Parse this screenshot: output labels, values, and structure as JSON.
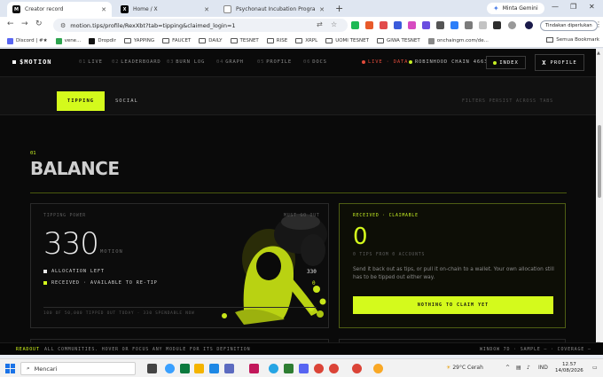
{
  "browser": {
    "tabs": [
      {
        "title": "Creator record",
        "active": true
      },
      {
        "title": "Home / X",
        "active": false
      },
      {
        "title": "Psychonaut Incubation Progra...",
        "active": false
      }
    ],
    "profile": "Minta Gemini",
    "url": "motion.tips/profile/RexXbt?tab=tipping&claimed_login=1",
    "action_button": "Tindakan diperlukan",
    "bookmarks": [
      "Discord | #★",
      "vene...",
      "Dropdir",
      "YAPPING",
      "FAUCET",
      "DAILY",
      "TESNET",
      "RISE",
      "XRPL",
      "UOMI TESNET",
      "GIWA TESNET",
      "onchaingm.com/de..."
    ],
    "all_bookmarks": "Semua Bookmark"
  },
  "site": {
    "brand": "$MOTION",
    "nav": [
      {
        "num": "01",
        "label": "LIVE"
      },
      {
        "num": "02",
        "label": "LEADERBOARD"
      },
      {
        "num": "03",
        "label": "BURN LOG"
      },
      {
        "num": "04",
        "label": "GRAPH"
      },
      {
        "num": "05",
        "label": "PROFILE"
      },
      {
        "num": "06",
        "label": "DOCS"
      }
    ],
    "live_status": "LIVE · DATA",
    "chain_status": "ROBINHOOD CHAIN 4663",
    "index_button": "INDEX",
    "profile_button": "PROFILE",
    "tabs": {
      "tipping": "TIPPING",
      "social": "SOCIAL"
    },
    "filters_note": "FILTERS PERSIST ACROSS TABS",
    "section_num": "01",
    "section_title": "BALANCE",
    "left_card": {
      "label": "TIPPING POWER",
      "label_right": "MUST GO OUT",
      "value": "330",
      "unit": "MOTION",
      "rows": [
        {
          "label": "ALLOCATION LEFT",
          "value": "330"
        },
        {
          "label": "RECEIVED · AVAILABLE TO RE-TIP",
          "value": "0"
        }
      ],
      "footer": "100 OF 50,000 TIPPED OUT TODAY · 330 SPENDABLE NOW"
    },
    "right_card": {
      "label": "RECEIVED · CLAIMABLE",
      "value": "0",
      "sub": "0 TIPS FROM 0 ACCOUNTS",
      "desc": "Send it back out as tips, or pull it on-chain to a wallet. Your own allocation still has to be tipped out either way.",
      "button": "NOTHING TO CLAIM YET"
    },
    "readout": {
      "key": "READOUT",
      "text": "ALL COMMUNITIES. HOVER OR FOCUS ANY MODULE FOR ITS DEFINITION",
      "window": "WINDOW 7D · SAMPLE – · COVERAGE –"
    },
    "colors": {
      "accent": "#d4fa1c",
      "live": "#e14b3b",
      "bg": "#0a0a0a"
    }
  },
  "taskbar": {
    "search": "Mencari",
    "weather": "29°C  Cerah",
    "lang": "IND",
    "time": "12.57",
    "date": "14/08/2026"
  }
}
